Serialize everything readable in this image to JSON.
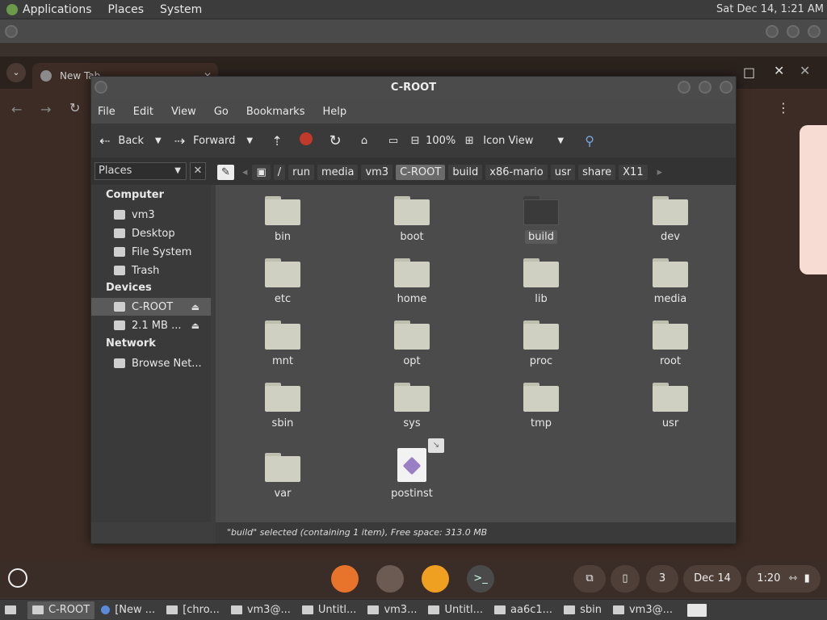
{
  "top_panel": {
    "applications": "Applications",
    "places": "Places",
    "system": "System",
    "clock": "Sat Dec 14,  1:21 AM"
  },
  "chrome": {
    "tab_title": "New Tab"
  },
  "window": {
    "title": "C-ROOT",
    "menu": [
      "File",
      "Edit",
      "View",
      "Go",
      "Bookmarks",
      "Help"
    ],
    "toolbar": {
      "back": "Back",
      "forward": "Forward",
      "zoom": "100%",
      "view_mode": "Icon View"
    },
    "places_label": "Places",
    "breadcrumbs": [
      "/",
      "run",
      "media",
      "vm3",
      "C-ROOT",
      "build",
      "x86-mario",
      "usr",
      "share",
      "X11"
    ],
    "sidebar": {
      "computer_header": "Computer",
      "computer_items": [
        "vm3",
        "Desktop",
        "File System",
        "Trash"
      ],
      "devices_header": "Devices",
      "device_items": [
        "C-ROOT",
        "2.1 MB ..."
      ],
      "network_header": "Network",
      "network_items": [
        "Browse Net..."
      ]
    },
    "files": [
      "bin",
      "boot",
      "build",
      "dev",
      "etc",
      "home",
      "lib",
      "media",
      "mnt",
      "opt",
      "proc",
      "root",
      "sbin",
      "sys",
      "tmp",
      "usr",
      "var",
      "postinst"
    ],
    "status": "\"build\" selected (containing 1 item), Free space: 313.0 MB"
  },
  "shelf": {
    "notif_count": "3",
    "date": "Dec 14",
    "time": "1:20"
  },
  "taskbar": [
    "C-ROOT",
    "[New ...",
    "[chro...",
    "vm3@...",
    "Untitl...",
    "vm3...",
    "Untitl...",
    "aa6c1...",
    "sbin",
    "vm3@..."
  ]
}
